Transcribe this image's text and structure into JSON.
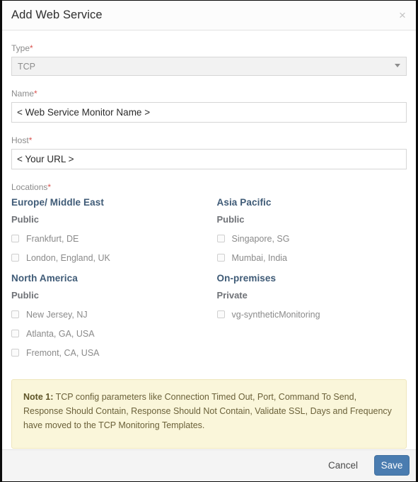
{
  "modal": {
    "title": "Add Web Service",
    "close_icon": "close-icon",
    "close_glyph": "×"
  },
  "form": {
    "type": {
      "label": "Type",
      "required_mark": "*",
      "value": "TCP",
      "caret_icon": "chevron-down-icon"
    },
    "name": {
      "label": "Name",
      "required_mark": "*",
      "value": "< Web Service Monitor Name >"
    },
    "host": {
      "label": "Host",
      "required_mark": "*",
      "value": "< Your URL >"
    },
    "locations": {
      "label": "Locations",
      "required_mark": "*",
      "regions": [
        {
          "title": "Europe/ Middle East",
          "visibility": "Public",
          "items": [
            {
              "label": "Frankfurt, DE",
              "checked": false
            },
            {
              "label": "London, England, UK",
              "checked": false
            }
          ]
        },
        {
          "title": "Asia Pacific",
          "visibility": "Public",
          "items": [
            {
              "label": "Singapore, SG",
              "checked": false
            },
            {
              "label": "Mumbai, India",
              "checked": false
            }
          ]
        },
        {
          "title": "North America",
          "visibility": "Public",
          "items": [
            {
              "label": "New Jersey, NJ",
              "checked": false
            },
            {
              "label": "Atlanta, GA, USA",
              "checked": false
            },
            {
              "label": "Fremont, CA, USA",
              "checked": false
            }
          ]
        },
        {
          "title": "On-premises",
          "visibility": "Private",
          "items": [
            {
              "label": "vg-syntheticMonitoring",
              "checked": false
            }
          ]
        }
      ]
    }
  },
  "note": {
    "prefix": "Note 1:",
    "body": " TCP config parameters like Connection Timed Out, Port, Command To Send, Response Should Contain, Response Should Not Contain, Validate SSL, Days and Frequency have moved to the TCP Monitoring Templates."
  },
  "footer": {
    "cancel_label": "Cancel",
    "save_label": "Save"
  },
  "colors": {
    "accent_blue": "#4a7cb0",
    "region_heading": "#3e5a76",
    "required_red": "#d9534f",
    "note_bg": "#faf6da",
    "note_border": "#efe6bb",
    "footer_bg": "#f4f4f4"
  }
}
